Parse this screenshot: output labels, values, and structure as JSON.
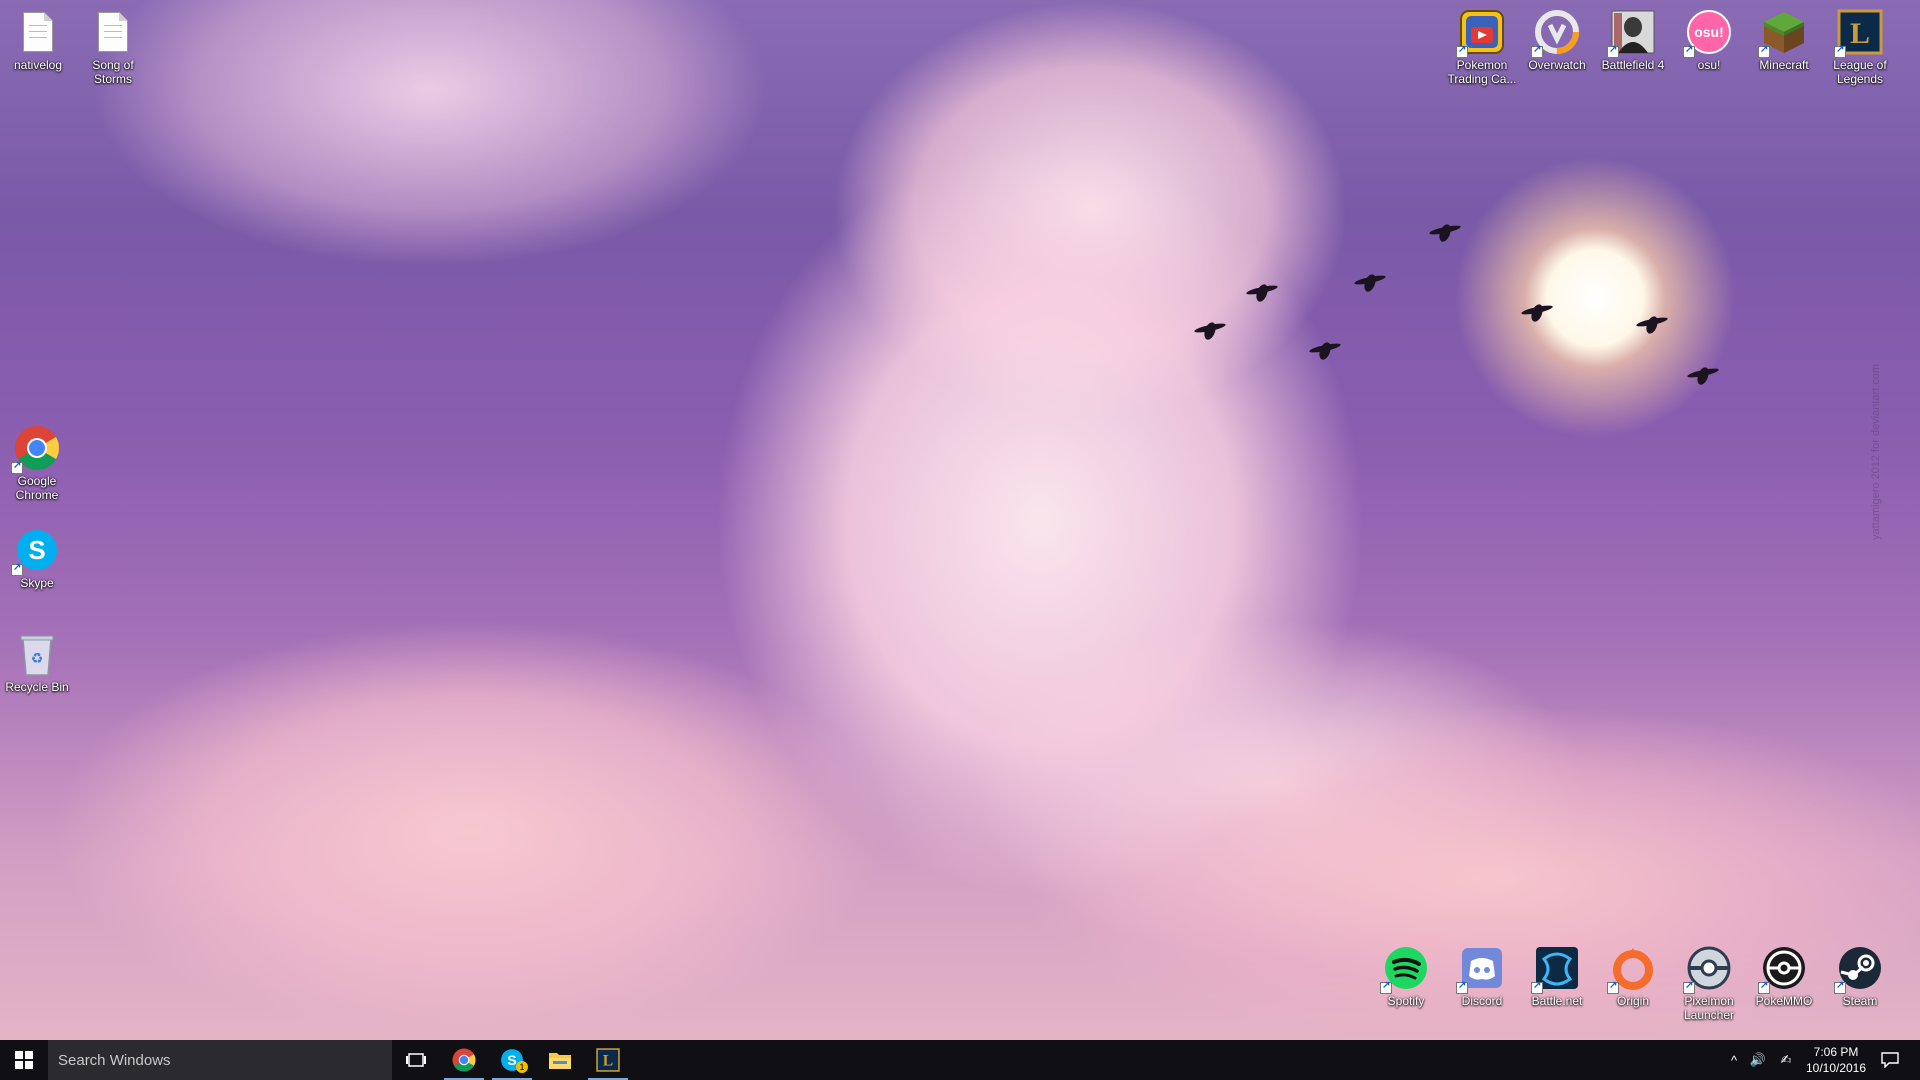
{
  "desktop": {
    "icons_left": [
      {
        "label": "nativelog",
        "icon": "document-icon"
      },
      {
        "label": "Song of\nStorms",
        "icon": "document-icon"
      },
      {
        "label": "Google\nChrome",
        "icon": "chrome-icon"
      },
      {
        "label": "Skype",
        "icon": "skype-icon"
      },
      {
        "label": "Recycle Bin",
        "icon": "recycle-bin-icon"
      }
    ],
    "icons_top_right": [
      {
        "label": "Pokemon\nTrading Ca...",
        "icon": "pokemon-tcg-icon"
      },
      {
        "label": "Overwatch",
        "icon": "overwatch-icon"
      },
      {
        "label": "Battlefield 4",
        "icon": "battlefield-4-icon"
      },
      {
        "label": "osu!",
        "icon": "osu-icon"
      },
      {
        "label": "Minecraft",
        "icon": "minecraft-icon"
      },
      {
        "label": "League of\nLegends",
        "icon": "league-of-legends-icon"
      }
    ],
    "icons_bottom_right": [
      {
        "label": "Spotify",
        "icon": "spotify-icon"
      },
      {
        "label": "Discord",
        "icon": "discord-icon"
      },
      {
        "label": "Battle.net",
        "icon": "battlenet-icon"
      },
      {
        "label": "Origin",
        "icon": "origin-icon"
      },
      {
        "label": "Pixelmon\nLauncher",
        "icon": "pixelmon-icon"
      },
      {
        "label": "PokeMMO",
        "icon": "pokemmo-icon"
      },
      {
        "label": "Steam",
        "icon": "steam-icon"
      }
    ],
    "wallpaper_watermark": "yattamigero 2012 for deviantart.com",
    "osu_text": "osu!",
    "league_letter": "L"
  },
  "taskbar": {
    "search_placeholder": "Search Windows",
    "pinned": [
      {
        "name": "task-view",
        "icon": "task-view-icon"
      },
      {
        "name": "chrome",
        "icon": "chrome-icon"
      },
      {
        "name": "skype",
        "icon": "skype-icon",
        "badge": "1"
      },
      {
        "name": "file-explorer",
        "icon": "folder-icon"
      },
      {
        "name": "league-client",
        "icon": "league-of-legends-icon"
      }
    ],
    "tray": {
      "chevron": "^",
      "volume": "🔊",
      "pen": "✍",
      "time": "7:06 PM",
      "date": "10/10/2016"
    }
  },
  "colors": {
    "taskbar_bg": "#101014",
    "accent": "#7aa7dc"
  }
}
